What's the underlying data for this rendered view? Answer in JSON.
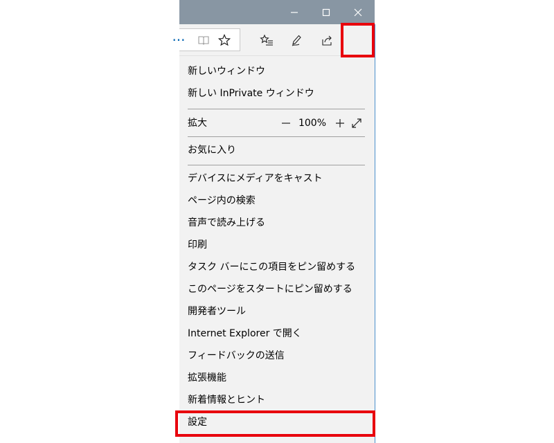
{
  "menu": {
    "items": [
      {
        "label": "新しいウィンドウ"
      },
      {
        "label": "新しい InPrivate ウィンドウ"
      },
      {
        "label": "拡大"
      },
      {
        "label": "お気に入り"
      },
      {
        "label": "デバイスにメディアをキャスト"
      },
      {
        "label": "ページ内の検索"
      },
      {
        "label": "音声で読み上げる"
      },
      {
        "label": "印刷"
      },
      {
        "label": "タスク バーにこの項目をピン留めする"
      },
      {
        "label": "このページをスタートにピン留めする"
      },
      {
        "label": "開発者ツール"
      },
      {
        "label": "Internet Explorer で開く"
      },
      {
        "label": "フィードバックの送信"
      },
      {
        "label": "拡張機能"
      },
      {
        "label": "新着情報とヒント"
      },
      {
        "label": "設定"
      }
    ],
    "zoom": {
      "value": "100%"
    }
  },
  "toolbar": {
    "more_label": "···"
  },
  "colors": {
    "titlebar": "#8896a3",
    "accent": "#0063b1",
    "highlight": "#e8000d",
    "menu_bg": "#f2f2f2"
  }
}
